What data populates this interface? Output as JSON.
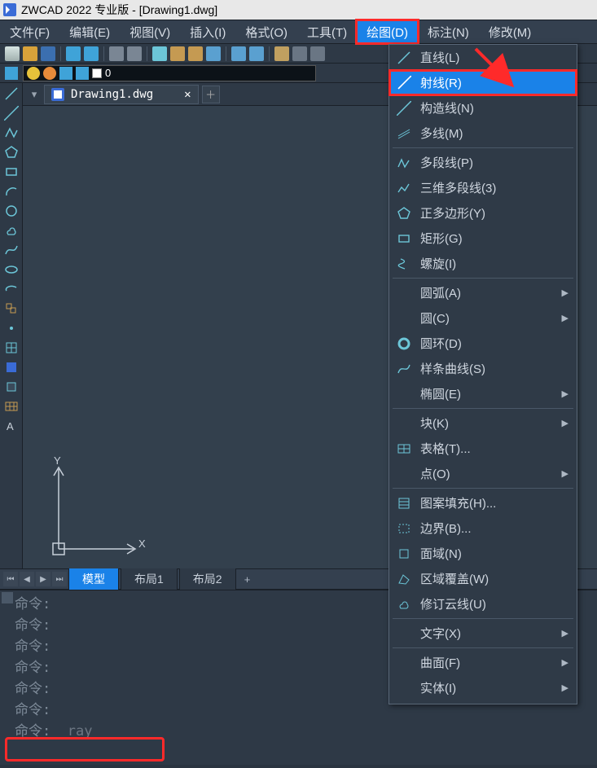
{
  "title": "ZWCAD 2022 专业版 - [Drawing1.dwg]",
  "menubar": {
    "file": "文件(F)",
    "edit": "编辑(E)",
    "view": "视图(V)",
    "insert": "插入(I)",
    "format": "格式(O)",
    "tools": "工具(T)",
    "draw": "绘图(D)",
    "dim": "标注(N)",
    "modify": "修改(M)"
  },
  "layer": {
    "name": "0"
  },
  "doc": {
    "tab": "Drawing1.dwg"
  },
  "axes": {
    "x": "X",
    "y": "Y"
  },
  "layout_tabs": {
    "model": "模型",
    "layout1": "布局1",
    "layout2": "布局2"
  },
  "cmd": {
    "prompt": "命令:",
    "input": "_ray"
  },
  "dropdown": {
    "line": "直线(L)",
    "ray": "射线(R)",
    "xline": "构造线(N)",
    "mline": "多线(M)",
    "pline": "多段线(P)",
    "pline3d": "三维多段线(3)",
    "polygon": "正多边形(Y)",
    "rect": "矩形(G)",
    "helix": "螺旋(I)",
    "arc": "圆弧(A)",
    "circle": "圆(C)",
    "donut": "圆环(D)",
    "spline": "样条曲线(S)",
    "ellipse": "椭圆(E)",
    "block": "块(K)",
    "table": "表格(T)...",
    "point": "点(O)",
    "hatch": "图案填充(H)...",
    "boundary": "边界(B)...",
    "region": "面域(N)",
    "wipeout": "区域覆盖(W)",
    "revcloud": "修订云线(U)",
    "text": "文字(X)",
    "surface": "曲面(F)",
    "solid": "实体(I)"
  }
}
